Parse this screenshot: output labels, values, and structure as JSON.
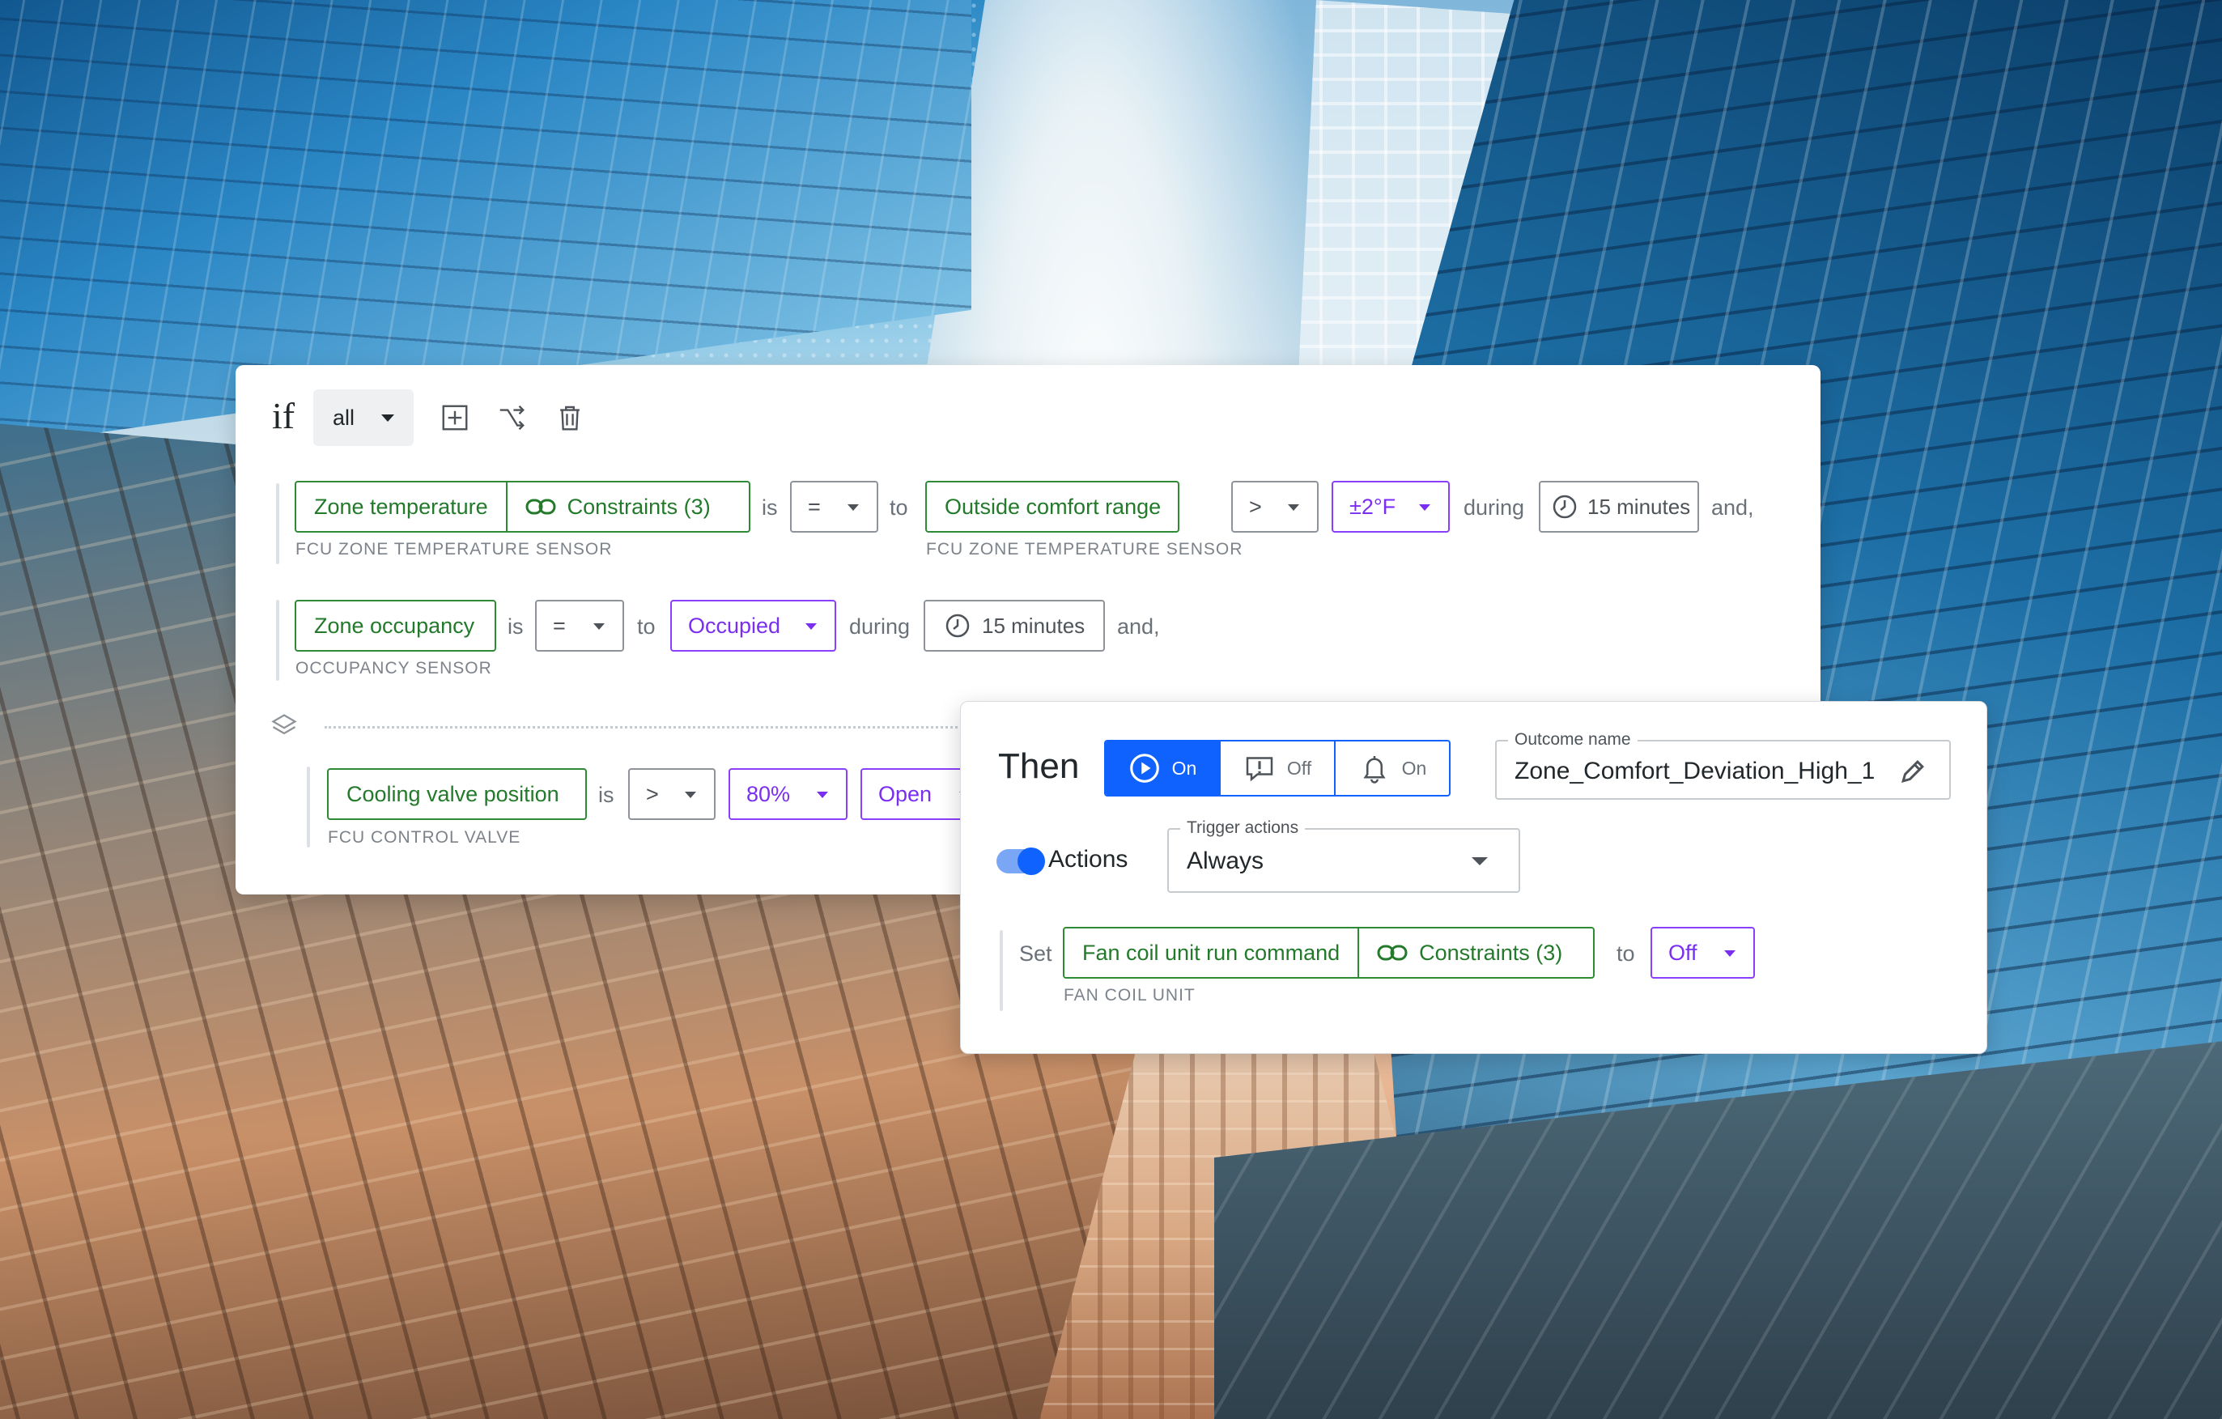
{
  "rule": {
    "if_label": "if",
    "match_mode": "all",
    "toolbar": {
      "add_label": "add",
      "branch_label": "branch",
      "delete_label": "delete"
    },
    "conditions": [
      {
        "point": "Zone temperature",
        "constraints": "Constraints (3)",
        "source": "FCU ZONE TEMPERATURE SENSOR",
        "is": "is",
        "operator": "=",
        "to": "to",
        "target": "Outside comfort range",
        "target_source": "FCU ZONE TEMPERATURE SENSOR",
        "comparator": ">",
        "tolerance": "±2°F",
        "during": "during",
        "duration": "15 minutes",
        "joiner": "and,"
      },
      {
        "point": "Zone occupancy",
        "source": "OCCUPANCY SENSOR",
        "is": "is",
        "operator": "=",
        "to": "to",
        "value": "Occupied",
        "during": "during",
        "duration": "15 minutes",
        "joiner": "and,"
      },
      {
        "point": "Cooling valve position",
        "source": "FCU CONTROL VALVE",
        "is": "is",
        "operator": ">",
        "value": "80%",
        "state": "Open"
      }
    ]
  },
  "outcome": {
    "title": "Then",
    "segments": [
      {
        "label": "On",
        "icon": "play-circle-icon"
      },
      {
        "label": "Off",
        "icon": "alert-message-icon"
      },
      {
        "label": "On",
        "icon": "bell-icon"
      }
    ],
    "name_label": "Outcome name",
    "name_value": "Zone_Comfort_Deviation_High_1",
    "actions_label": "Actions",
    "actions_enabled": true,
    "trigger_label": "Trigger actions",
    "trigger_value": "Always",
    "set": {
      "set_label": "Set",
      "point": "Fan coil unit run command",
      "constraints": "Constraints (3)",
      "source": "FAN COIL UNIT",
      "to": "to",
      "value": "Off"
    }
  },
  "colors": {
    "green": "#2f8a35",
    "purple": "#8a3ffc",
    "blue": "#0f62fe"
  }
}
